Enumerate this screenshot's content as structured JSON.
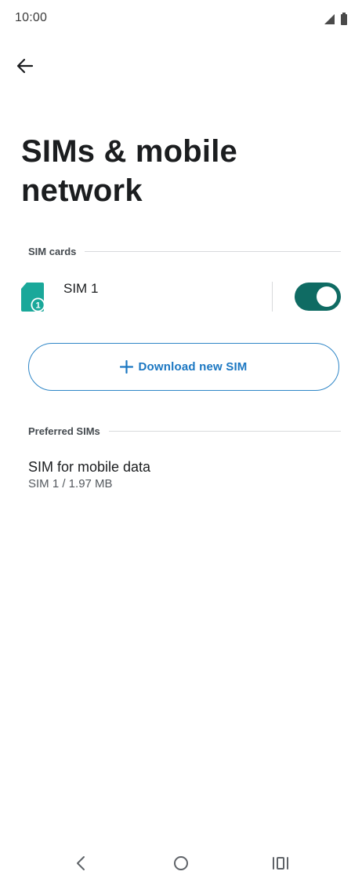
{
  "status_bar": {
    "time": "10:00",
    "icons": [
      "signal-icon",
      "battery-icon"
    ]
  },
  "header": {
    "back_icon": "back-arrow-icon",
    "title": "SIMs & mobile network"
  },
  "sim_cards": {
    "section_label": "SIM cards",
    "sims": [
      {
        "name": "SIM 1",
        "slot_badge": "1",
        "enabled": true,
        "icon": "sim-card-icon"
      }
    ]
  },
  "download": {
    "label": "Download new SIM",
    "icon": "plus-icon"
  },
  "preferred": {
    "section_label": "Preferred SIMs",
    "items": [
      {
        "title": "SIM for mobile data",
        "summary": "SIM 1 / 1.97 MB"
      }
    ]
  },
  "nav_bar": {
    "buttons": [
      "back-nav-icon",
      "home-nav-icon",
      "recents-nav-icon"
    ]
  },
  "colors": {
    "accent_teal": "#0f6b63",
    "sim_teal": "#1aa89a",
    "button_blue": "#1b77c2"
  }
}
